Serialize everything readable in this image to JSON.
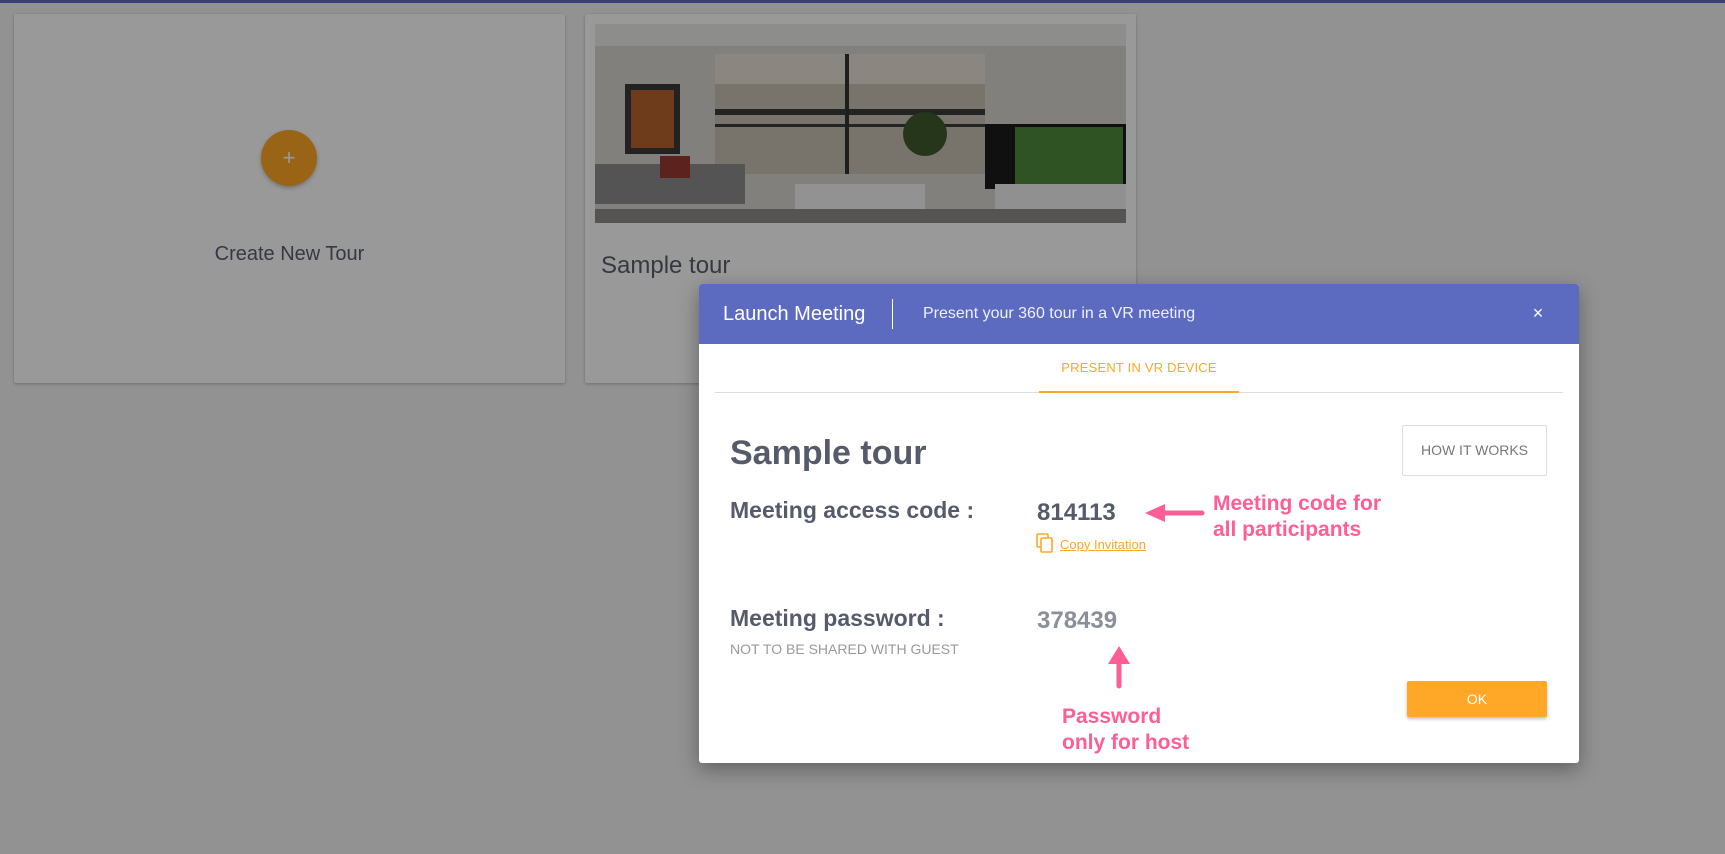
{
  "cards": {
    "create_label": "Create New Tour",
    "plus_symbol": "+",
    "sample_label": "Sample tour"
  },
  "modal": {
    "title": "Launch Meeting",
    "subtitle": "Present your 360 tour in a VR meeting",
    "close_symbol": "×",
    "tabs": [
      {
        "label": "PRESENT IN VR DEVICE",
        "active": true
      }
    ],
    "tour_name": "Sample tour",
    "how_it_works_label": "HOW IT WORKS",
    "access_code_label": "Meeting access code :",
    "access_code_value": "814113",
    "copy_invitation_label": "Copy Invitation",
    "password_label": "Meeting password :",
    "password_note": "NOT TO BE SHARED WITH GUEST",
    "password_value": "378439",
    "ok_label": "OK"
  },
  "annotations": {
    "code_note_line1": "Meeting code for",
    "code_note_line2": "all participants",
    "password_note_line1": "Password",
    "password_note_line2": "only for host"
  },
  "icons": {
    "add": "plus-icon",
    "close": "close-icon",
    "copy": "copy-icon",
    "arrow_left": "arrow-left-icon",
    "arrow_up": "arrow-up-icon"
  },
  "colors": {
    "header": "#5c6bc0",
    "accent": "#ffa726",
    "annotation": "#ff5d95",
    "text": "#555b6b"
  }
}
